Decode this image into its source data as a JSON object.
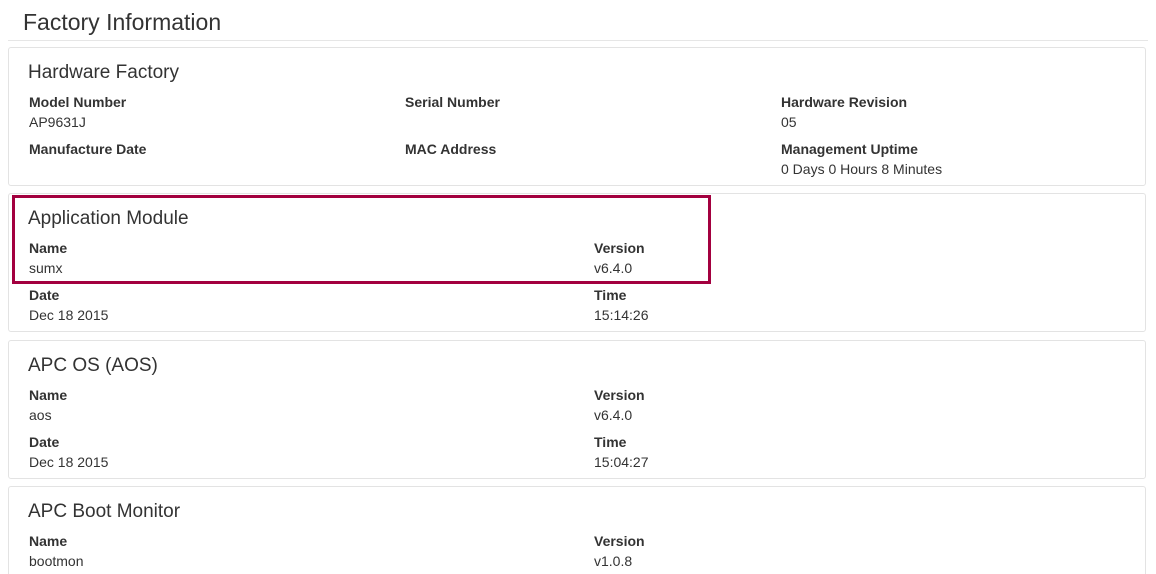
{
  "page": {
    "title": "Factory Information"
  },
  "hardware_factory": {
    "title": "Hardware Factory",
    "model_number_label": "Model Number",
    "model_number_value": "AP9631J",
    "serial_number_label": "Serial Number",
    "serial_number_value": "",
    "hardware_revision_label": "Hardware Revision",
    "hardware_revision_value": "05",
    "manufacture_date_label": "Manufacture Date",
    "manufacture_date_value": "",
    "mac_address_label": "MAC Address",
    "mac_address_value": "",
    "management_uptime_label": "Management Uptime",
    "management_uptime_value": "0 Days 0 Hours 8 Minutes"
  },
  "application_module": {
    "title": "Application Module",
    "name_label": "Name",
    "name_value": "sumx",
    "version_label": "Version",
    "version_value": "v6.4.0",
    "date_label": "Date",
    "date_value": "Dec 18 2015",
    "time_label": "Time",
    "time_value": "15:14:26"
  },
  "apc_os": {
    "title": "APC OS (AOS)",
    "name_label": "Name",
    "name_value": "aos",
    "version_label": "Version",
    "version_value": "v6.4.0",
    "date_label": "Date",
    "date_value": "Dec 18 2015",
    "time_label": "Time",
    "time_value": "15:04:27"
  },
  "apc_boot_monitor": {
    "title": "APC Boot Monitor",
    "name_label": "Name",
    "name_value": "bootmon",
    "version_label": "Version",
    "version_value": "v1.0.8"
  },
  "colors": {
    "highlight": "#a3003f",
    "panel_border": "#e3e3e3",
    "text": "#333333"
  }
}
